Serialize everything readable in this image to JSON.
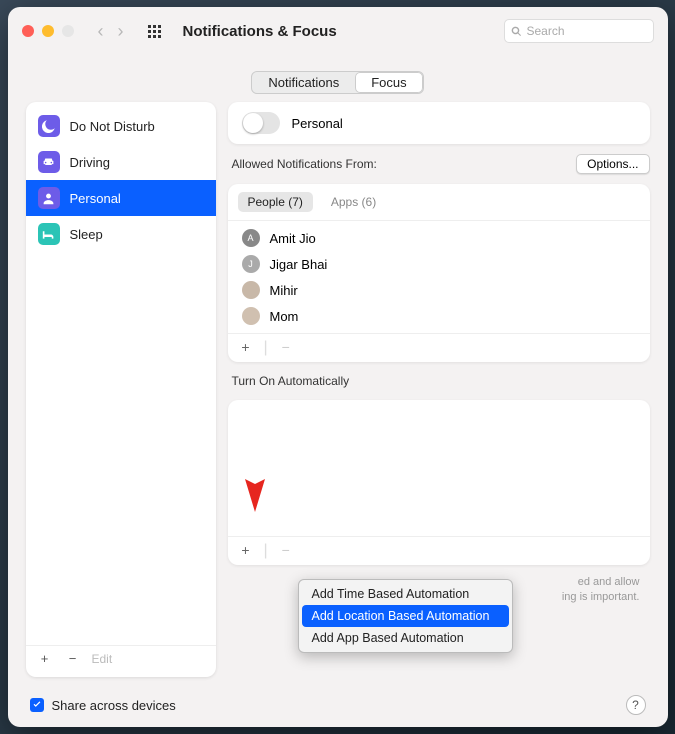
{
  "title": "Notifications & Focus",
  "search_placeholder": "Search",
  "tabs": {
    "notifications": "Notifications",
    "focus": "Focus"
  },
  "sidebar": {
    "items": [
      {
        "label": "Do Not Disturb"
      },
      {
        "label": "Driving"
      },
      {
        "label": "Personal"
      },
      {
        "label": "Sleep"
      }
    ],
    "edit": "Edit"
  },
  "main": {
    "toggle_label": "Personal",
    "allowed_label": "Allowed Notifications From:",
    "options": "Options...",
    "list_tabs": {
      "people": "People (7)",
      "apps": "Apps (6)"
    },
    "people": [
      {
        "name": "Amit Jio"
      },
      {
        "name": "Jigar Bhai"
      },
      {
        "name": "Mihir"
      },
      {
        "name": "Mom"
      }
    ],
    "auto_label": "Turn On Automatically",
    "note_a": "ed and allow",
    "note_b": "ing is important."
  },
  "popup": {
    "time": "Add Time Based Automation",
    "location": "Add Location Based Automation",
    "app": "Add App Based Automation"
  },
  "share": "Share across devices",
  "help": "?"
}
